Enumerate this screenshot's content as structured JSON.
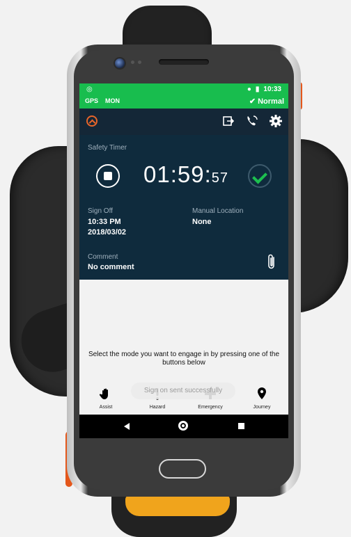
{
  "statusbar": {
    "time": "10:33",
    "row2_left": [
      "GPS",
      "MON"
    ],
    "status": "✔ Normal"
  },
  "timer_panel": {
    "label": "Safety Timer",
    "time_main": "01:59:",
    "time_sec": "57"
  },
  "sign_off": {
    "label": "Sign Off",
    "time": "10:33 PM",
    "date": "2018/03/02"
  },
  "manual_location": {
    "label": "Manual Location",
    "value": "None"
  },
  "comment": {
    "label": "Comment",
    "value": "No comment"
  },
  "prompt": "Select the mode you want to engage in by pressing one of the buttons below",
  "toast": "Sign on sent successfully",
  "modes": [
    {
      "label": "Assist",
      "icon": "hand-icon"
    },
    {
      "label": "Hazard",
      "icon": "exclamation-icon"
    },
    {
      "label": "Emergency",
      "icon": "plus-icon"
    },
    {
      "label": "Journey",
      "icon": "location-pin-icon"
    }
  ],
  "colors": {
    "status_green": "#18bd4e",
    "panel_navy": "#0f2b3d",
    "accent_orange": "#e8652a",
    "check_green": "#1cbf4f"
  }
}
